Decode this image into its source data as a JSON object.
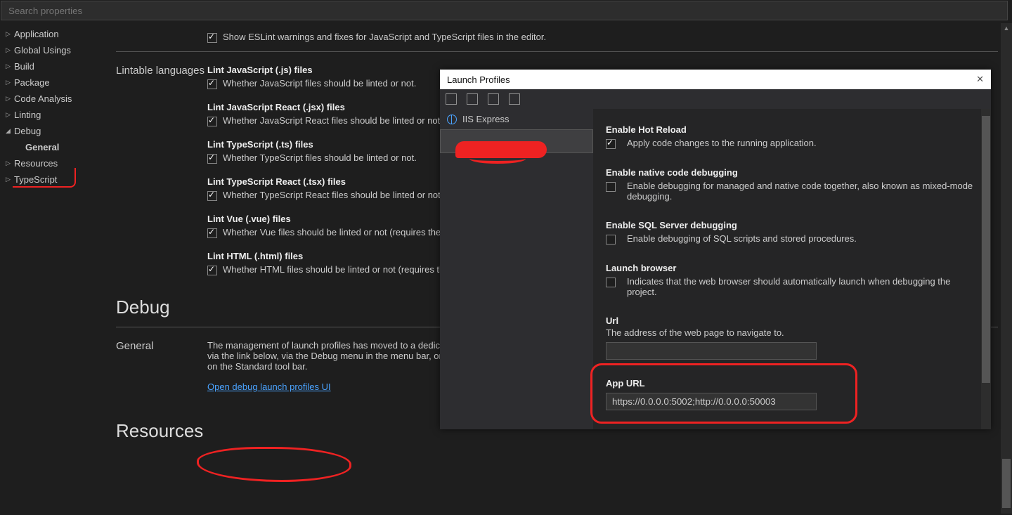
{
  "search": {
    "placeholder": "Search properties"
  },
  "nav": {
    "items": [
      {
        "label": "Application",
        "expanded": false
      },
      {
        "label": "Global Usings",
        "expanded": false
      },
      {
        "label": "Build",
        "expanded": false
      },
      {
        "label": "Package",
        "expanded": false
      },
      {
        "label": "Code Analysis",
        "expanded": false
      },
      {
        "label": "Linting",
        "expanded": false
      },
      {
        "label": "Debug",
        "expanded": true
      },
      {
        "label": "Resources",
        "expanded": false
      },
      {
        "label": "TypeScript",
        "expanded": false
      }
    ],
    "debug_sub": "General"
  },
  "eslint": {
    "show_label": "Show ESLint warnings and fixes for JavaScript and TypeScript files in the editor.",
    "show_checked": true
  },
  "lintable": {
    "heading": "Lintable languages",
    "items": [
      {
        "title": "Lint JavaScript (.js) files",
        "desc": "Whether JavaScript files should be linted or not.",
        "checked": true
      },
      {
        "title": "Lint JavaScript React (.jsx) files",
        "desc": "Whether JavaScript React files should be linted or not.",
        "checked": true
      },
      {
        "title": "Lint TypeScript (.ts) files",
        "desc": "Whether TypeScript files should be linted or not.",
        "checked": true
      },
      {
        "title": "Lint TypeScript React (.tsx) files",
        "desc": "Whether TypeScript React files should be linted or not.",
        "checked": true
      },
      {
        "title": "Lint Vue (.vue) files",
        "desc": "Whether Vue files should be linted or not (requires the HT",
        "checked": true
      },
      {
        "title": "Lint HTML (.html) files",
        "desc": "Whether HTML files should be linted or not (requires the",
        "checked": true
      }
    ]
  },
  "debug_section": {
    "heading": "Debug",
    "general_label": "General",
    "general_text": "The management of launch profiles has moved to a dedicated dialog. It may be accessed via the link below, via the Debug menu in the menu bar, or via the Debug Target command on the Standard tool bar.",
    "link": "Open debug launch profiles UI"
  },
  "resources_heading": "Resources",
  "dialog": {
    "title": "Launch Profiles",
    "profiles": [
      {
        "name": "IIS Express",
        "selected": false
      }
    ],
    "panel": {
      "hot_reload": {
        "title": "Enable Hot Reload",
        "desc": "Apply code changes to the running application.",
        "checked": true
      },
      "native": {
        "title": "Enable native code debugging",
        "desc": "Enable debugging for managed and native code together, also known as mixed-mode debugging.",
        "checked": false
      },
      "sql": {
        "title": "Enable SQL Server debugging",
        "desc": "Enable debugging of SQL scripts and stored procedures.",
        "checked": false
      },
      "launch_browser": {
        "title": "Launch browser",
        "desc": "Indicates that the web browser should automatically launch when debugging the project.",
        "checked": false
      },
      "url": {
        "title": "Url",
        "desc": "The address of the web page to navigate to.",
        "value": ""
      },
      "app_url": {
        "title": "App URL",
        "value": "https://0.0.0.0:5002;http://0.0.0.0:50003"
      }
    }
  }
}
